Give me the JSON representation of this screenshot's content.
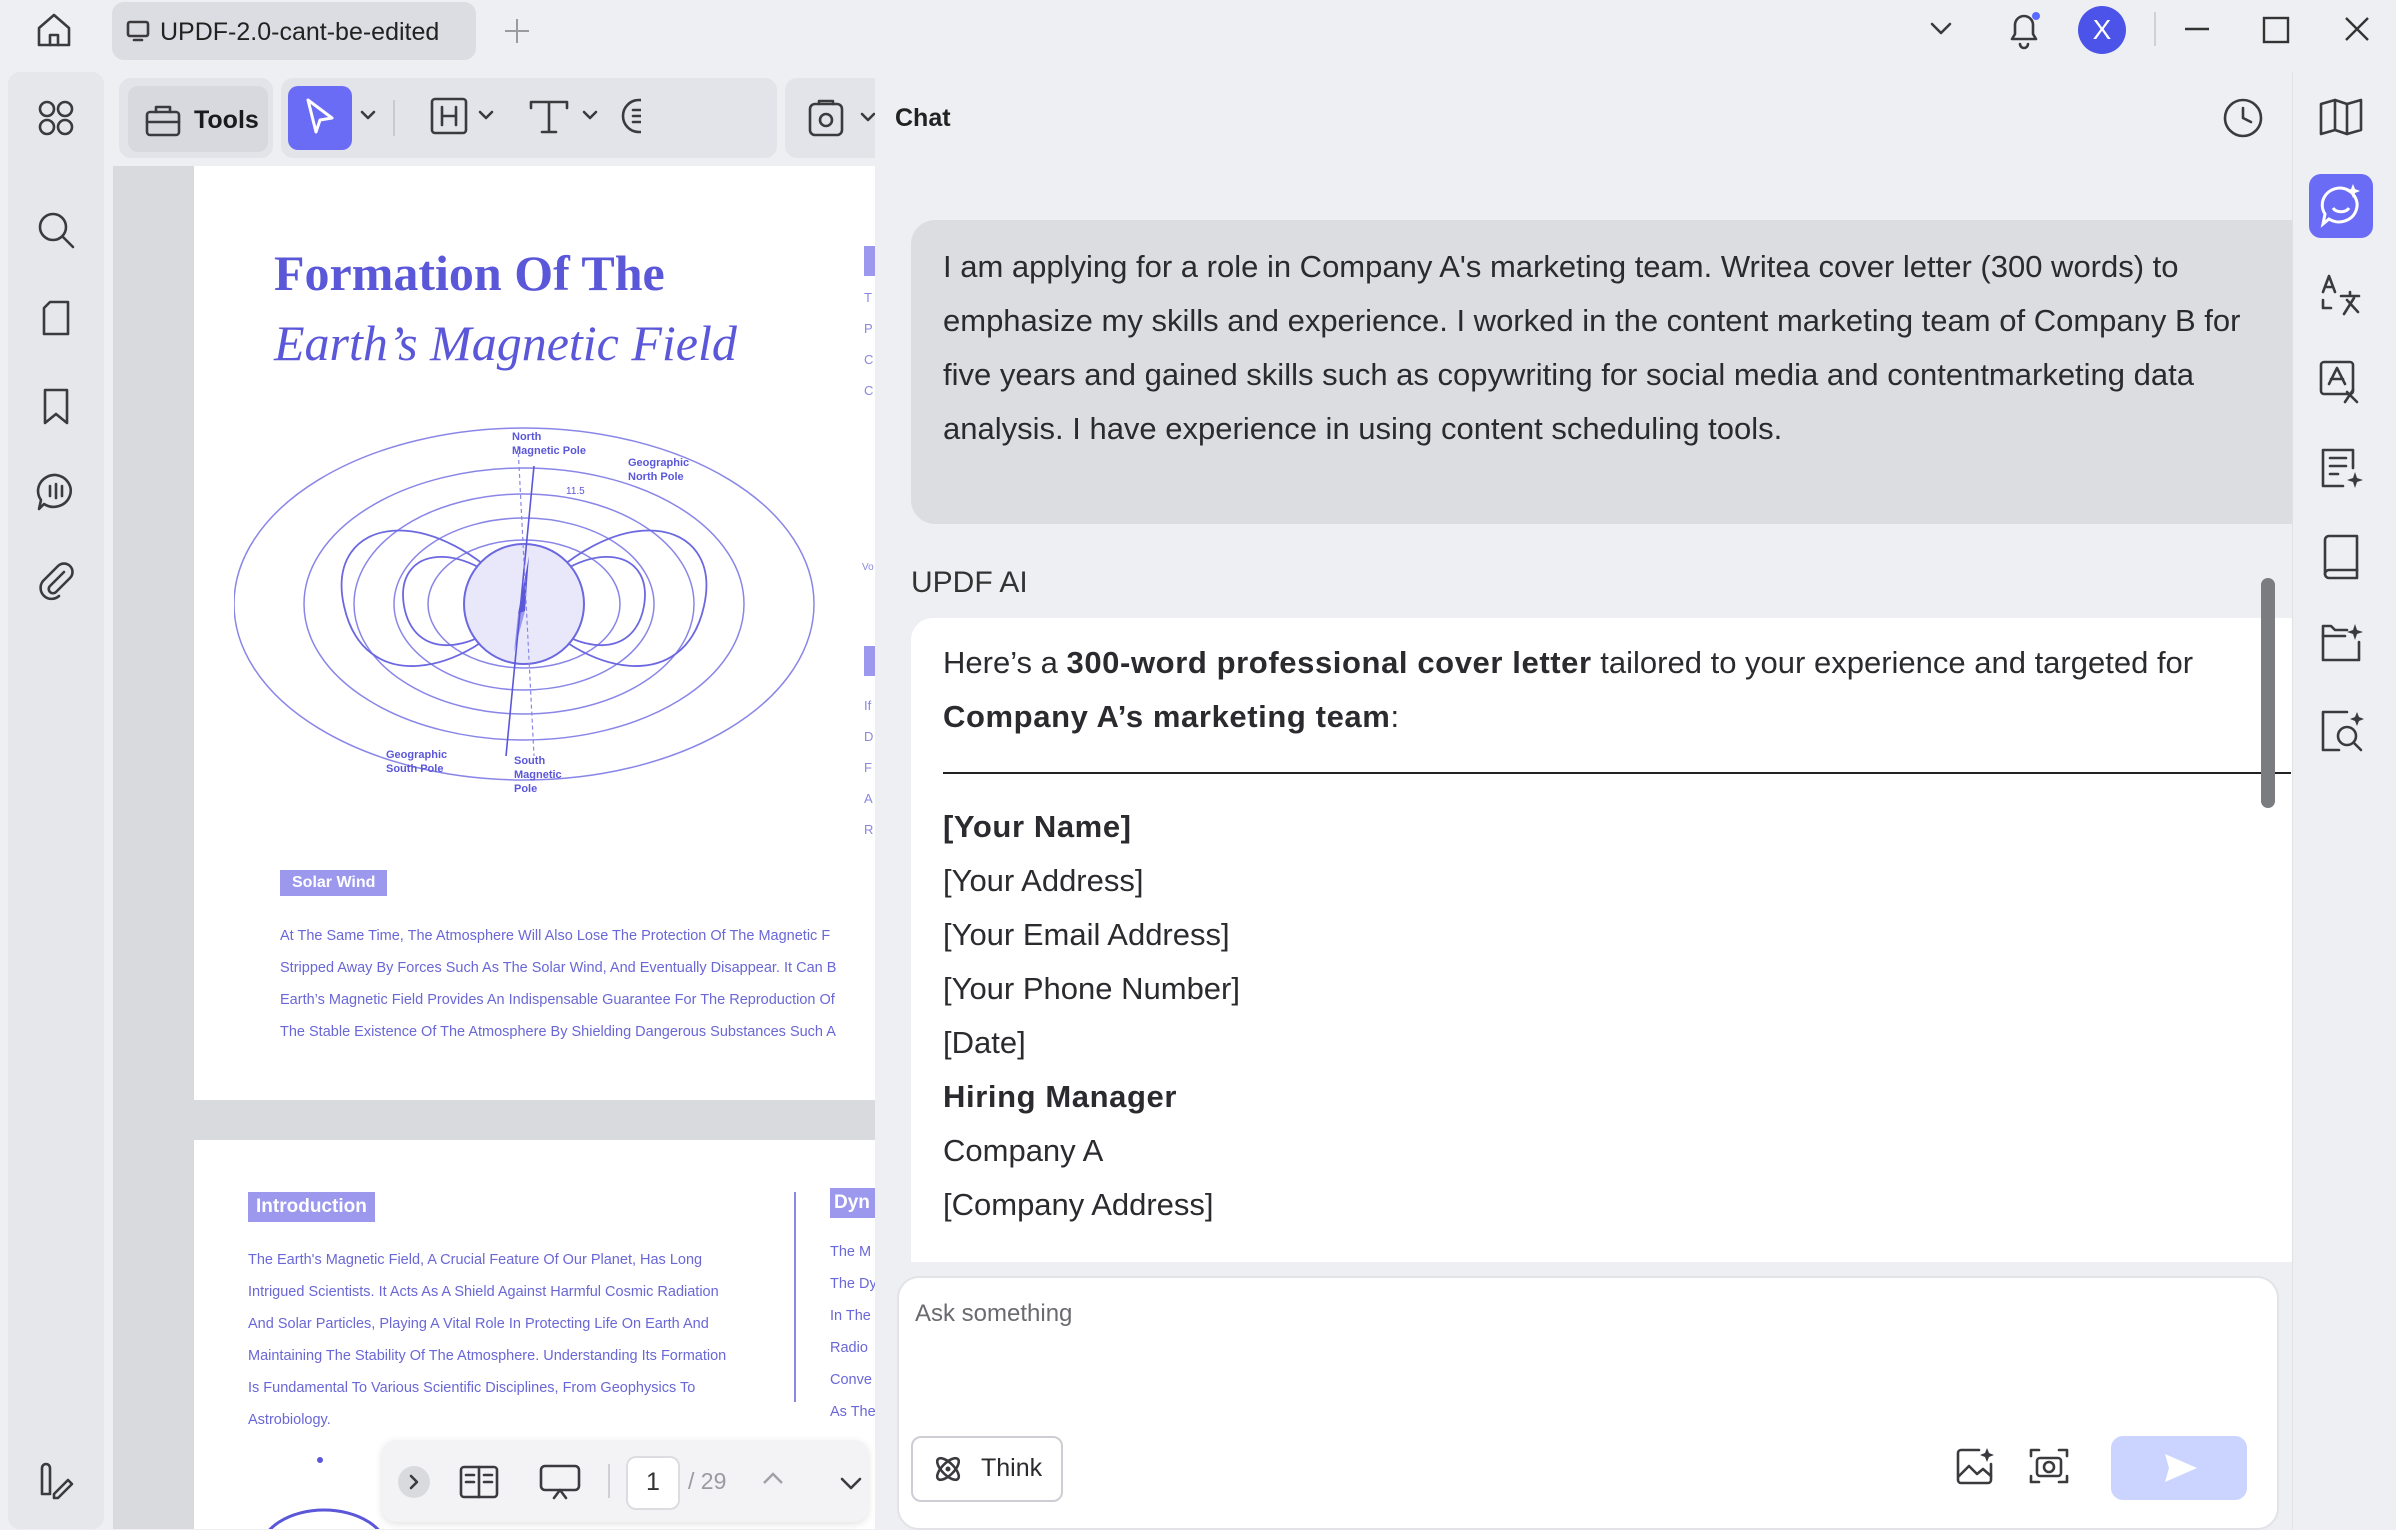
{
  "tab": {
    "title": "UPDF-2.0-cant-be-edited"
  },
  "user": {
    "avatar_letter": "X"
  },
  "toolbar": {
    "tools_label": "Tools"
  },
  "document": {
    "page1": {
      "title_line1": "Formation Of The",
      "title_line2": "Earth’s Magnetic Field",
      "diagram_labels": {
        "north_magnetic": [
          "North",
          "Magnetic Pole"
        ],
        "geo_north": [
          "Geographic",
          "North Pole"
        ],
        "geo_south": [
          "Geographic",
          "South Pole"
        ],
        "south_magnetic": [
          "South",
          "Magnetic",
          "Pole"
        ],
        "angle": "11.5"
      },
      "section_tag": "Solar Wind",
      "section_lines": [
        "At The Same Time, The Atmosphere Will Also Lose The Protection Of The Magnetic F",
        "Stripped Away By Forces Such As The Solar Wind, And Eventually Disappear. It Can B",
        "Earth’s Magnetic Field Provides An Indispensable Guarantee For The Reproduction Of",
        "The Stable Existence Of The Atmosphere By Shielding Dangerous Substances Such A"
      ],
      "right_column_letters": [
        "T",
        "P",
        "C",
        "C",
        "Vo",
        "If",
        "D",
        "F",
        "A",
        "R"
      ]
    },
    "page2": {
      "intro_tag": "Introduction",
      "intro_lines": [
        "The Earth's Magnetic Field, A Crucial Feature Of Our Planet, Has Long",
        "Intrigued Scientists. It Acts As A Shield Against Harmful Cosmic Radiation",
        "And Solar Particles, Playing A Vital Role In Protecting Life On Earth And",
        "Maintaining The Stability Of The Atmosphere. Understanding Its Formation",
        "Is Fundamental To Various Scientific Disciplines, From Geophysics To",
        "Astrobiology."
      ],
      "right_tag": "Dyn",
      "right_lines": [
        "The M",
        "The Dy",
        "In The",
        "Radio",
        "Conve",
        "As The"
      ]
    }
  },
  "page_nav": {
    "current": "1",
    "total": "/ 29"
  },
  "chat": {
    "title": "Chat",
    "user_message": "I am applying for a role in Company A's marketing team. Writea cover letter (300 words) to emphasize my skills and experience. I worked in the content marketing team of Company B for five years and gained skills such as copywriting for social media and contentmarketing data analysis. I have experience in using content scheduling tools.",
    "ai_label": "UPDF AI",
    "ai_intro_pre": "Here’s a ",
    "ai_intro_bold": "300-word professional cover letter",
    "ai_intro_mid": " tailored to your experience and targeted for ",
    "ai_intro_bold2": "Company A’s marketing team",
    "ai_intro_end": ":",
    "letter_lines": [
      {
        "text": "[Your Name]",
        "bold": true
      },
      {
        "text": "[Your Address]",
        "bold": false
      },
      {
        "text": "[Your Email Address]",
        "bold": false
      },
      {
        "text": "[Your Phone Number]",
        "bold": false
      },
      {
        "text": "[Date]",
        "bold": false
      },
      {
        "text": "Hiring Manager",
        "bold": true
      },
      {
        "text": "Company A",
        "bold": false
      },
      {
        "text": "[Company Address]",
        "bold": false
      }
    ],
    "input_placeholder": "Ask something",
    "think_label": "Think"
  },
  "colors": {
    "accent": "#6b6cf6",
    "doc_purple": "#5b57d9",
    "send_disabled": "#cbd4ff"
  }
}
